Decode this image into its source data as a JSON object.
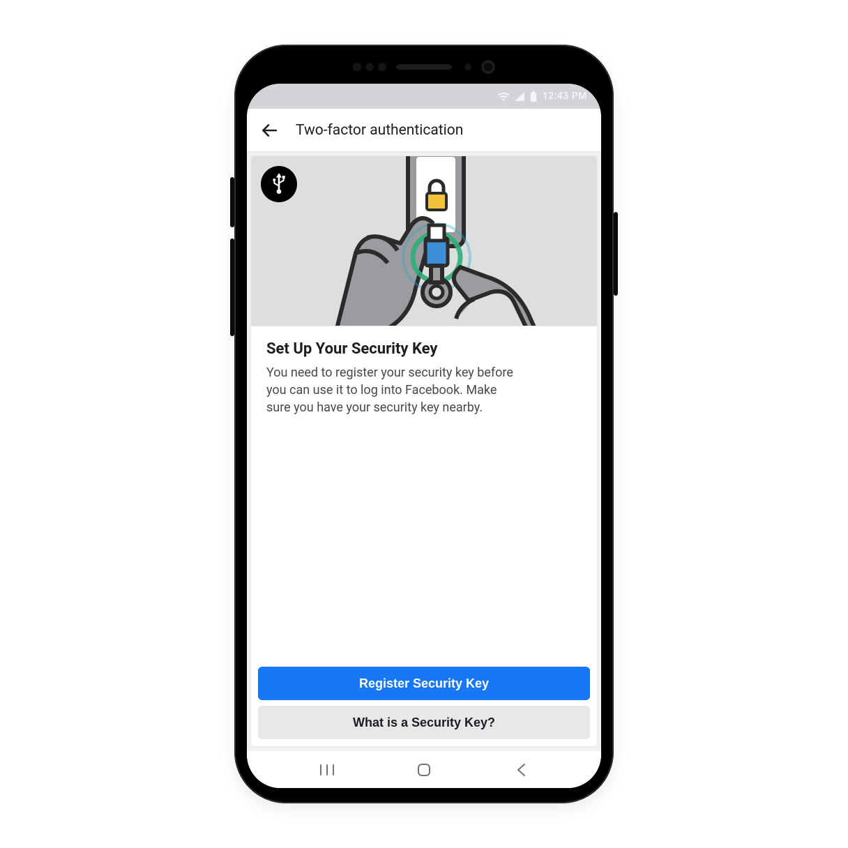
{
  "status": {
    "time": "12:43 PM"
  },
  "appbar": {
    "title": "Two-factor authentication"
  },
  "card": {
    "title": "Set Up Your Security Key",
    "description": "You need to register your security key before you can use it to log into Facebook. Make sure you have your security key nearby."
  },
  "actions": {
    "primary": "Register Security Key",
    "secondary": "What is a Security Key?"
  },
  "colors": {
    "primary": "#1877f2",
    "secondary_bg": "#e7e8ea",
    "illus_bg": "#dcdedf"
  }
}
